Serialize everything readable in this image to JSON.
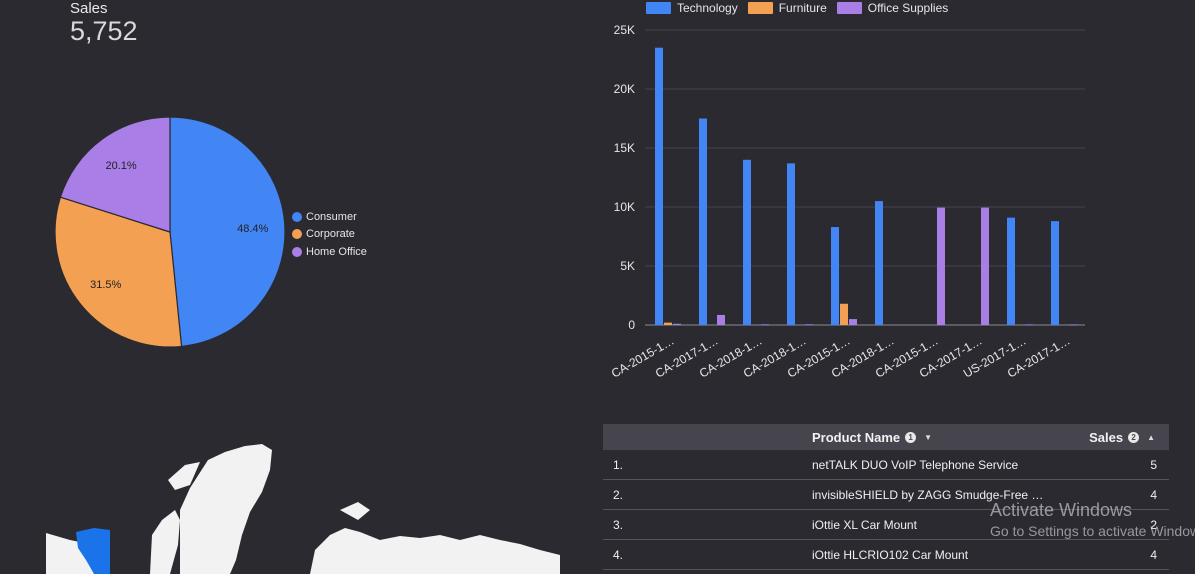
{
  "kpi": {
    "label": "Sales",
    "value": "5,752"
  },
  "pie_legend": [
    {
      "label": "Consumer",
      "color": "#4285f4"
    },
    {
      "label": "Corporate",
      "color": "#f4a053"
    },
    {
      "label": "Home Office",
      "color": "#a97ee6"
    }
  ],
  "bar_legend": [
    {
      "label": "Technology",
      "color": "#4285f4"
    },
    {
      "label": "Furniture",
      "color": "#f4a053"
    },
    {
      "label": "Office Supplies",
      "color": "#a97ee6"
    }
  ],
  "table": {
    "header": {
      "name": "Product Name",
      "name_badge": "1",
      "sales": "Sales",
      "sales_badge": "2"
    },
    "rows": [
      {
        "idx": "1.",
        "name": "netTALK DUO VoIP Telephone Service",
        "sales": "5"
      },
      {
        "idx": "2.",
        "name": "invisibleSHIELD by ZAGG Smudge-Free …",
        "sales": "4"
      },
      {
        "idx": "3.",
        "name": "iOttie XL Car Mount",
        "sales": "2"
      },
      {
        "idx": "4.",
        "name": "iOttie HLCRIO102 Car Mount",
        "sales": "4"
      }
    ]
  },
  "watermark": {
    "line1": "Activate Windows",
    "line2": "Go to Settings to activate Windows."
  },
  "chart_data": [
    {
      "type": "pie",
      "title": "",
      "categories": [
        "Consumer",
        "Corporate",
        "Home Office"
      ],
      "values": [
        48.4,
        31.5,
        20.1
      ],
      "labels": [
        "48.4%",
        "31.5%",
        "20.1%"
      ],
      "colors": [
        "#4285f4",
        "#f4a053",
        "#a97ee6"
      ],
      "legend": "right"
    },
    {
      "type": "bar",
      "title": "",
      "categories": [
        "CA-2015-1…",
        "CA-2017-1…",
        "CA-2018-1…",
        "CA-2018-1…",
        "CA-2015-1…",
        "CA-2018-1…",
        "CA-2015-1…",
        "CA-2017-1…",
        "US-2017-1…",
        "CA-2017-1…"
      ],
      "series": [
        {
          "name": "Technology",
          "color": "#4285f4",
          "values": [
            23500,
            17500,
            14000,
            13700,
            8300,
            10500,
            0,
            0,
            9100,
            8800
          ]
        },
        {
          "name": "Furniture",
          "color": "#f4a053",
          "values": [
            200,
            0,
            0,
            0,
            1800,
            0,
            0,
            0,
            0,
            0
          ]
        },
        {
          "name": "Office Supplies",
          "color": "#a97ee6",
          "values": [
            100,
            850,
            60,
            60,
            500,
            0,
            9950,
            9950,
            50,
            50
          ]
        }
      ],
      "yticks": [
        "0",
        "5K",
        "10K",
        "15K",
        "20K",
        "25K"
      ],
      "ylim": [
        0,
        25000
      ],
      "grid": true,
      "legend": "top"
    }
  ]
}
